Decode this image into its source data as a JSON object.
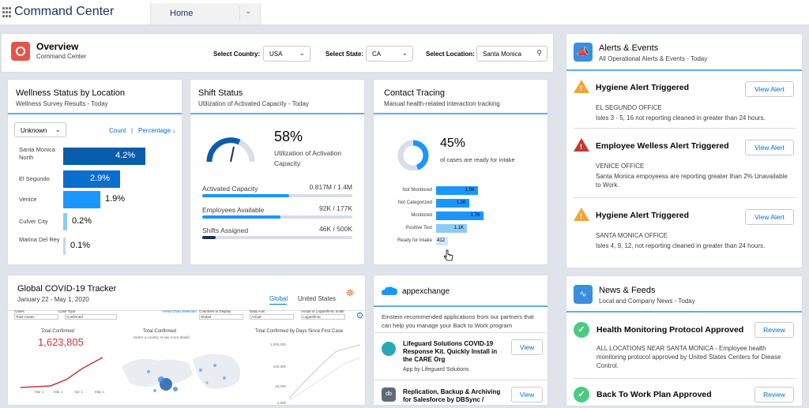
{
  "app": {
    "title": "Command Center",
    "tab": "Home"
  },
  "overview": {
    "title": "Overview",
    "subtitle": "Command Center",
    "country_label": "Select Country:",
    "country_value": "USA",
    "state_label": "Select State:",
    "state_value": "CA",
    "location_label": "Select Location:",
    "location_value": "Santa Monica"
  },
  "wellness": {
    "title": "Wellness Status by Location",
    "subtitle": "Wellness Survey Results - Today",
    "filter": "Unknown",
    "count_label": "Count",
    "pct_label": "Percentage ↓",
    "rows": [
      {
        "label": "Santa Monica North",
        "value": "4.2%"
      },
      {
        "label": "El Segundo",
        "value": "2.9%"
      },
      {
        "label": "Venice",
        "value": "1.9%"
      },
      {
        "label": "Culver City",
        "value": "0.2%"
      },
      {
        "label": "Marina Del Rey",
        "value": "0.1%"
      }
    ]
  },
  "shift": {
    "title": "Shift Status",
    "subtitle": "Utilization of Activated Capacity - Today",
    "pct": "58%",
    "caption": "Utilization of Activation Capacity",
    "rows": [
      {
        "label": "Activated Capacity",
        "value": "0.817M / 1.4M",
        "fraction": 0.58
      },
      {
        "label": "Employees Available",
        "value": "92K / 177K",
        "fraction": 0.52
      },
      {
        "label": "Shifts Assigned",
        "value": "46K / 500K",
        "fraction": 0.09
      }
    ]
  },
  "contact": {
    "title": "Contact Tracing",
    "subtitle": "Manual health-related interaction tracking",
    "pct": "45%",
    "caption": "of cases are ready for intake",
    "rows": [
      {
        "label": "Not Monitored",
        "value": "1.5K",
        "num": 1500
      },
      {
        "label": "Not Categorized",
        "value": "1.2K",
        "num": 1200
      },
      {
        "label": "Monitored",
        "value": "1.7K",
        "num": 1700
      },
      {
        "label": "Positive Test",
        "value": "1.1K",
        "num": 1100
      },
      {
        "label": "Ready for Intake",
        "value": "412",
        "num": 412
      }
    ]
  },
  "covid": {
    "title": "Global COVID-19 Tracker",
    "subtitle": "January 22 - May 1, 2020",
    "tab_global": "Global",
    "tab_us": "United States",
    "filter_labels": [
      "Cases",
      "Case Type",
      "Trend Chart Selection",
      "Countries to Display",
      "Data Axis",
      "Actual or Logarithmic Scale"
    ],
    "filter_values": [
      "Total Cases",
      "Confirmed",
      "Global",
      "Actual",
      "Logarithmic"
    ],
    "total_label": "Total Confirmed",
    "total_value": "1,623,805",
    "map_title": "Total Confirmed",
    "map_note": "Select a country to see more details",
    "trend_title": "Total Confirmed by Days Since First Case",
    "axis_months": [
      "Mar 1",
      "Mar 1",
      "Apr 1",
      "May 1"
    ],
    "y_ticks": [
      "1,000,000",
      "100,000",
      "10,000",
      "1,000"
    ]
  },
  "appexchange": {
    "title": "appexchange",
    "description": "Einstein recommended applications from our partners that can help you manage your Back to Work program",
    "apps": [
      {
        "name": "Lifeguard Solutions COVID-19 Response Kit. Quickly Install in the CARE Org",
        "by": "App by Lifeguard Solutions",
        "button": "View"
      },
      {
        "name": "Replication, Backup & Archiving for Salesforce by DBSync / Avankia",
        "by": "",
        "button": "View"
      }
    ]
  },
  "alerts": {
    "title": "Alerts & Events",
    "subtitle": "All Operational Alerts & Events  - Today",
    "items": [
      {
        "title": "Hygiene Alert Triggered",
        "office": "EL SEGUNDO OFFICE",
        "text": "Isles 3 - 5, 16 not reporting cleaned in greater than 24 hours.",
        "button": "View Alert"
      },
      {
        "title": "Employee Welless Alert Triggered",
        "office": "VENICE OFFICE",
        "text": "Santa Monica empoyeess are reporting greater than 2% Unavailable to Work.",
        "button": "View Alert"
      },
      {
        "title": "Hygiene Alert Triggered",
        "office": "SANTA MONICA OFFICE",
        "text": "Isles 4, 9, 12, not reporting cleaned in greater than 24 hours.",
        "button": "View Alert"
      }
    ]
  },
  "news": {
    "title": "News & Feeds",
    "subtitle": "Local and Company News - Today",
    "items": [
      {
        "title": "Health Monitoring Protocol Approved",
        "text": "ALL LOCATIONS NEAR SANTA MONICA - Employee health monitoring protocol approved by United States Centers for Diease Control.",
        "button": "Review"
      },
      {
        "title": "Back To Work Plan Approved",
        "text": "",
        "button": "Review"
      }
    ]
  },
  "colors": {
    "accent": "#0070d2",
    "bar_dark": "#0b5cab",
    "bar_mid": "#1b96ff",
    "bar_light": "#8ccbf5",
    "gauge": "#0b5cab",
    "warn_orange": "#f2a33a",
    "warn_red": "#c23934",
    "success": "#4bca81"
  }
}
